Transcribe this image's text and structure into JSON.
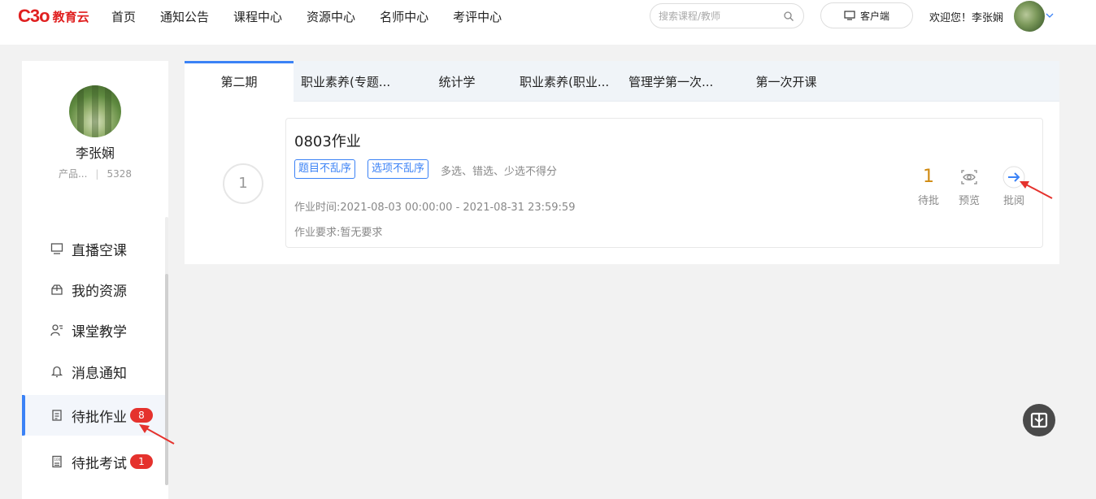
{
  "header": {
    "logo_text": "教育云",
    "logo_mark": "C3o",
    "nav": [
      "首页",
      "通知公告",
      "课程中心",
      "资源中心",
      "名师中心",
      "考评中心"
    ],
    "search_placeholder": "搜索课程/教师",
    "client_label": "客户端",
    "welcome": "欢迎您！李张娴"
  },
  "sidebar": {
    "user_name": "李张娴",
    "user_dept": "产品...",
    "user_id": "5328",
    "menu": [
      {
        "label": "直播空课",
        "icon": "monitor-icon"
      },
      {
        "label": "我的资源",
        "icon": "box-icon"
      },
      {
        "label": "课堂教学",
        "icon": "teacher-icon"
      },
      {
        "label": "消息通知",
        "icon": "bell-icon"
      },
      {
        "label": "待批作业",
        "icon": "homework-icon",
        "badge": "8",
        "active": true
      },
      {
        "label": "待批考试",
        "icon": "exam-icon",
        "badge": "1"
      }
    ]
  },
  "tabs": [
    "第二期",
    "职业素养(专题...",
    "统计学",
    "职业素养(职业...",
    "管理学第一次...",
    "第一次开课"
  ],
  "assignment": {
    "index": "1",
    "title": "0803作业",
    "tags": [
      "题目不乱序",
      "选项不乱序"
    ],
    "rule": "多选、错选、少选不得分",
    "time": "作业时间:2021-08-03 00:00:00 - 2021-08-31 23:59:59",
    "requirement": "作业要求:暂无要求",
    "pending_count": "1",
    "pending_label": "待批",
    "preview_label": "预览",
    "review_label": "批阅"
  },
  "colors": {
    "accent": "#3b82f6",
    "badge": "#e5322d",
    "logo": "#e02020",
    "pending": "#d08a10"
  }
}
